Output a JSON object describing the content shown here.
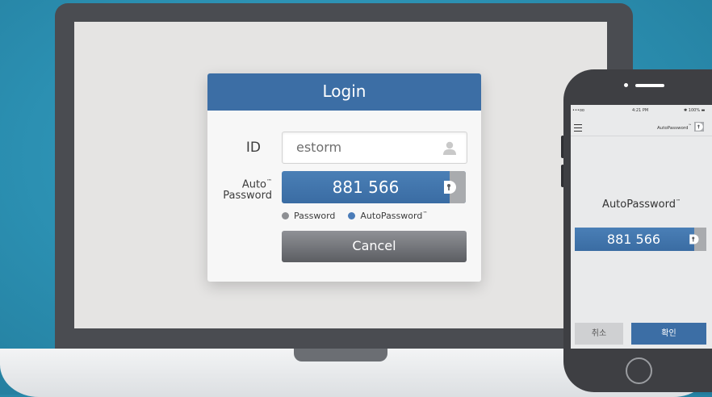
{
  "colors": {
    "background": "#2b8fb1",
    "header_blue": "#3c6ea5",
    "code_blue": "#4a7fb6",
    "cancel_grey": "#6f7176",
    "screen_grey": "#e5e4e3"
  },
  "login_dialog": {
    "title": "Login",
    "id_label": "ID",
    "id_value": "estorm",
    "password_label_line1": "Auto",
    "password_label_tm": "™",
    "password_label_line2": "Password",
    "auto_password_code": "881 566",
    "radio_options": [
      {
        "label": "Password",
        "selected": false
      },
      {
        "label": "AutoPassword",
        "tm": "™",
        "selected": true
      }
    ],
    "cancel_button": "Cancel",
    "icons": {
      "user": "user-icon",
      "autopassword": "autopassword-logo-icon"
    }
  },
  "phone": {
    "status_bar": {
      "carrier": "•••oo",
      "time": "4:21 PM",
      "battery": "✱ 100% ▬"
    },
    "app_bar": {
      "title": "AutoPassword",
      "title_tm": "™",
      "icons": {
        "menu": "hamburger-menu-icon",
        "logo": "autopassword-logo-icon"
      }
    },
    "heading": "AutoPassword",
    "heading_tm": "™",
    "code": "881 566",
    "cancel_button": "취소",
    "confirm_button": "확인"
  }
}
